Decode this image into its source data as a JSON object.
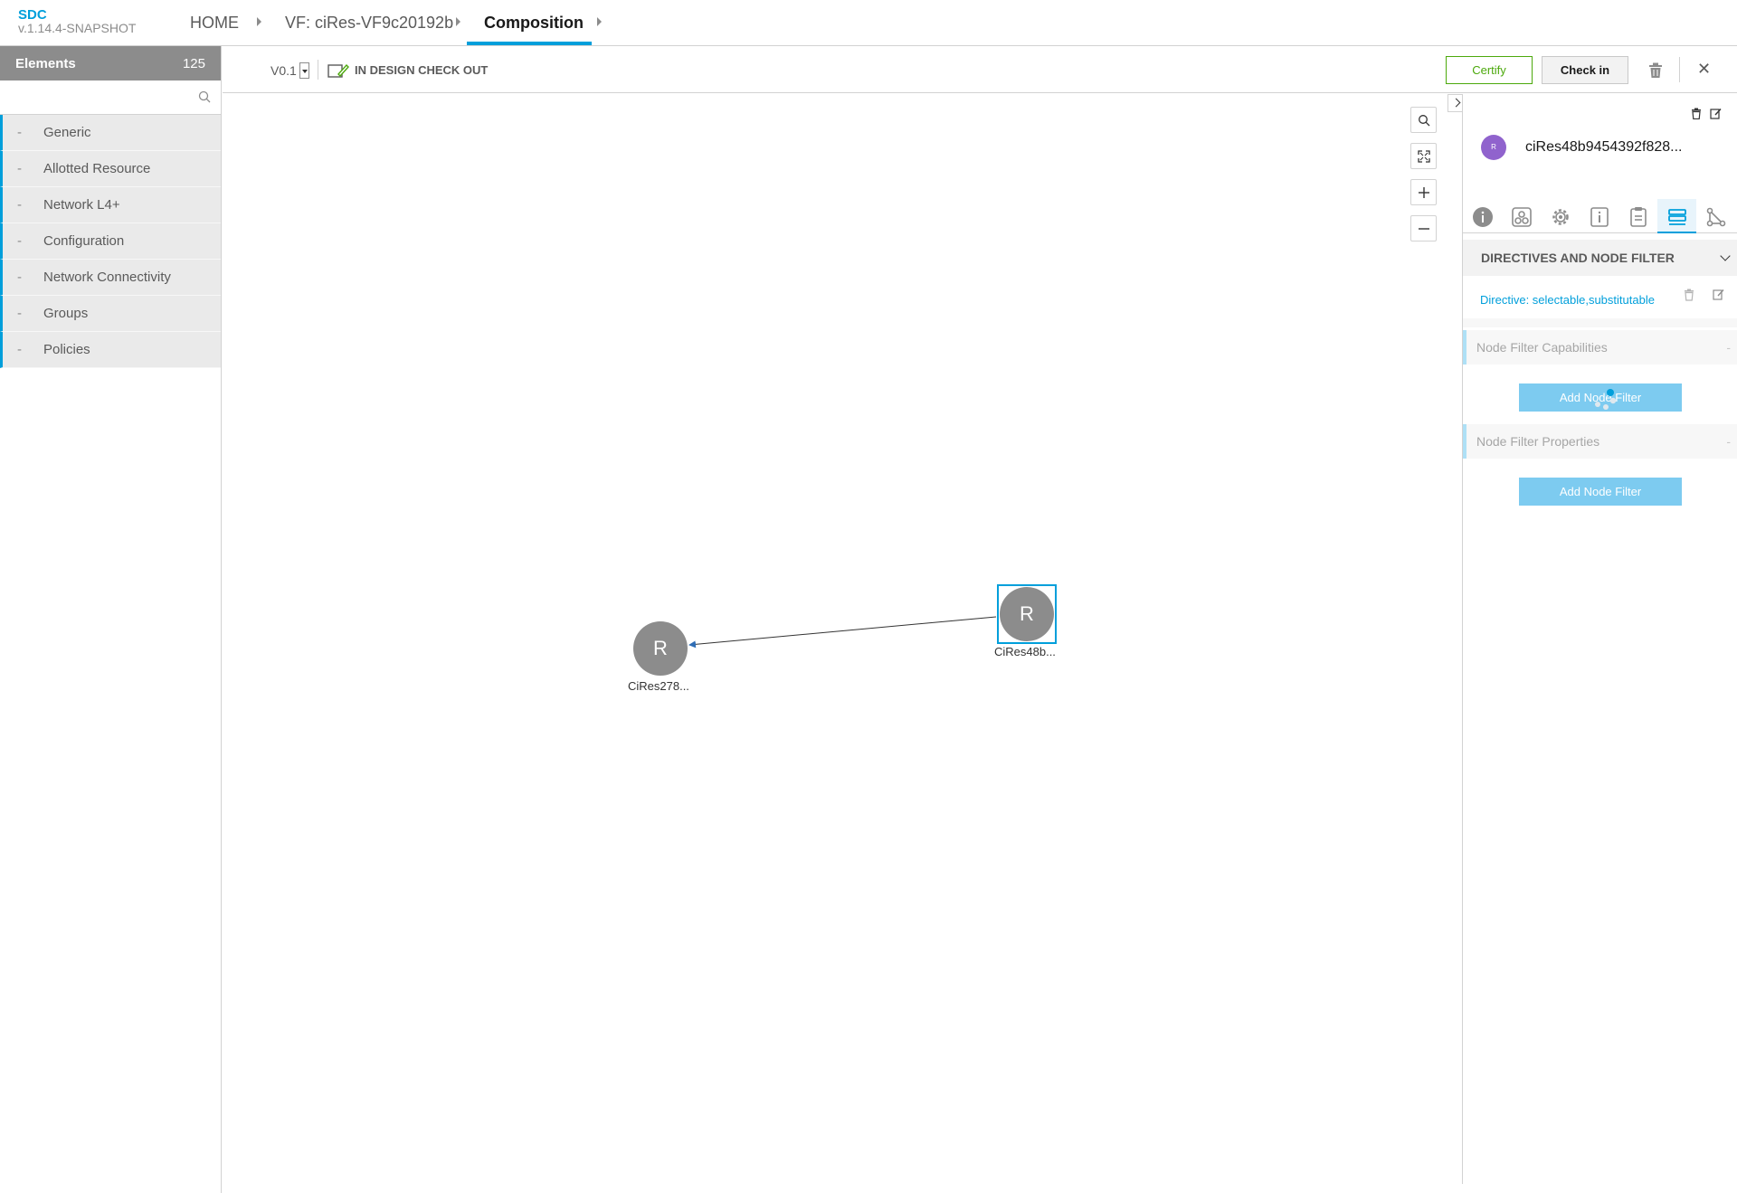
{
  "header": {
    "app_name": "SDC",
    "version": "v.1.14.4-SNAPSHOT",
    "breadcrumbs": [
      "HOME",
      "VF: ciRes-VF9c20192b",
      "Composition"
    ]
  },
  "palette": {
    "title": "Elements",
    "count": "125",
    "search_placeholder": "",
    "items": [
      {
        "dash": "-",
        "label": "Generic"
      },
      {
        "dash": "-",
        "label": "Allotted Resource"
      },
      {
        "dash": "-",
        "label": "Network L4+"
      },
      {
        "dash": "-",
        "label": "Configuration"
      },
      {
        "dash": "-",
        "label": "Network Connectivity"
      },
      {
        "dash": "-",
        "label": "Groups"
      },
      {
        "dash": "-",
        "label": "Policies"
      }
    ]
  },
  "toolbar": {
    "version": "V0.1",
    "status": "IN DESIGN CHECK OUT",
    "certify_label": "Certify",
    "checkin_label": "Check in",
    "close_label": "✕"
  },
  "canvas": {
    "nodes": [
      {
        "initial": "R",
        "label": "CiRes278..."
      },
      {
        "initial": "R",
        "label": "CiRes48b..."
      }
    ]
  },
  "right_panel": {
    "avatar_letter": "R",
    "instance_name": "ciRes48b9454392f828...",
    "section_title": "DIRECTIVES AND NODE FILTER",
    "directive": "Directive: selectable,substitutable",
    "capabilities_title": "Node Filter Capabilities",
    "properties_title": "Node Filter Properties",
    "collapse_marker": "-",
    "add_capability_button": "Add Node Filter",
    "add_property_button": "Add Node Filter"
  },
  "colors": {
    "accent": "#009fdb",
    "certify": "#4ca90c",
    "node": "#8c8c8c",
    "avatar": "#9063cd"
  }
}
